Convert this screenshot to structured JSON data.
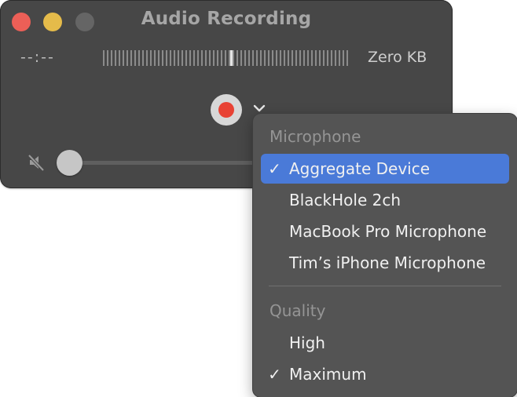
{
  "window": {
    "title": "Audio Recording",
    "elapsed_time": "--:--",
    "file_size": "Zero KB",
    "level_meter": 0.52,
    "volume": 0.0
  },
  "menu": {
    "microphone": {
      "header": "Microphone",
      "items": [
        {
          "label": "Aggregate Device",
          "check": "✓",
          "selected": true
        },
        {
          "label": "BlackHole 2ch",
          "check": "",
          "selected": false
        },
        {
          "label": "MacBook Pro Microphone",
          "check": "",
          "selected": false
        },
        {
          "label": "Tim’s iPhone Microphone",
          "check": "",
          "selected": false
        }
      ]
    },
    "quality": {
      "header": "Quality",
      "items": [
        {
          "label": "High",
          "check": ""
        },
        {
          "label": "Maximum",
          "check": "✓"
        }
      ]
    }
  },
  "colors": {
    "window_bg": "#474747",
    "menu_bg": "#545454",
    "highlight": "#4a7ad8",
    "record": "#e84234",
    "close": "#ec5f57",
    "minimize": "#e5bb4a"
  },
  "icons": [
    "mute-icon",
    "chevron-down-icon",
    "record-icon",
    "checkmark-icon"
  ]
}
